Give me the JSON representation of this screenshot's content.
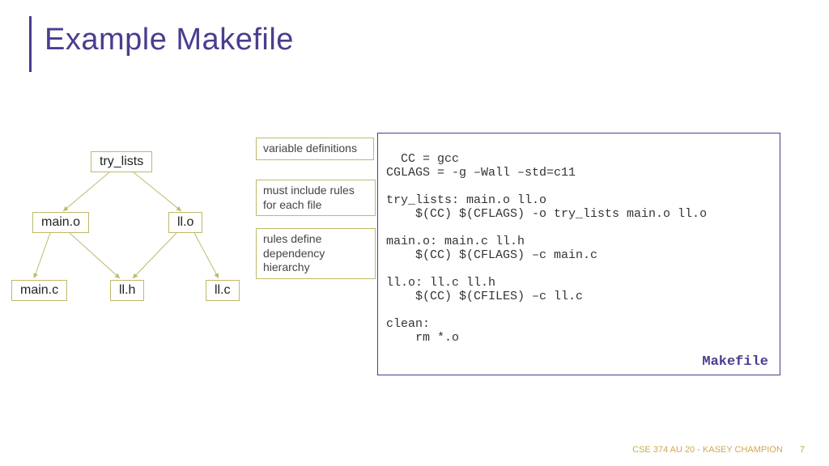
{
  "title": "Example Makefile",
  "tree": {
    "root": "try_lists",
    "left": "main.o",
    "right": "ll.o",
    "l1": "main.c",
    "l2": "ll.h",
    "l3": "ll.c"
  },
  "annotations": {
    "a1": "variable definitions",
    "a2": "must include rules for each file",
    "a3": "rules define dependency hierarchy"
  },
  "code": "CC = gcc\nCGLAGS = -g –Wall –std=c11\n\ntry_lists: main.o ll.o\n    $(CC) $(CFLAGS) -o try_lists main.o ll.o\n\nmain.o: main.c ll.h\n    $(CC) $(CFLAGS) –c main.c\n\nll.o: ll.c ll.h\n    $(CC) $(CFILES) –c ll.c\n\nclean:\n    rm *.o",
  "file_label": "Makefile",
  "footer": {
    "course": "CSE 374 AU 20 - KASEY CHAMPION",
    "page": "7"
  }
}
